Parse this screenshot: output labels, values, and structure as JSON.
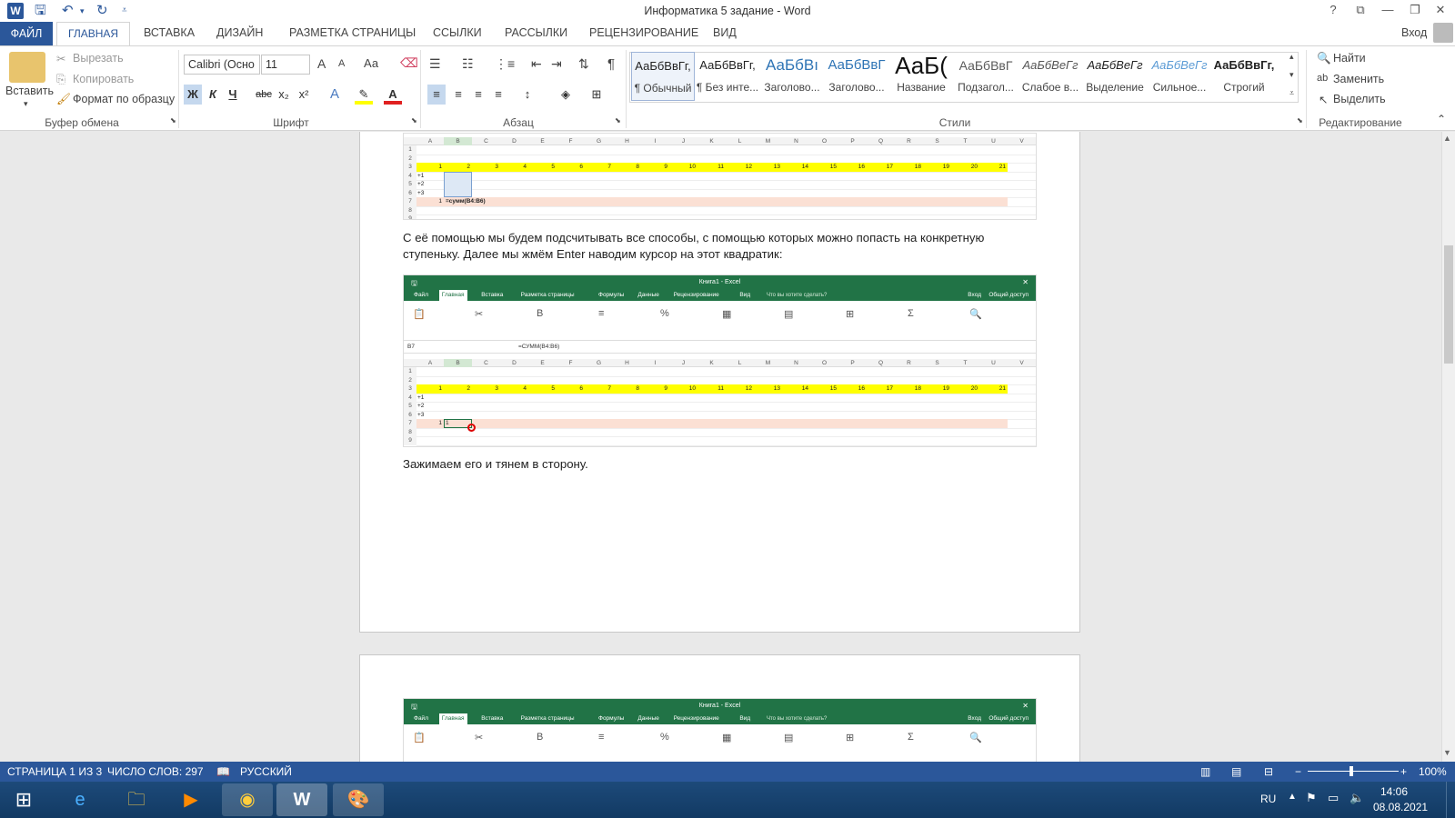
{
  "window": {
    "title": "Информатика 5 задание - Word",
    "help": "?",
    "signin": "Вход"
  },
  "tabs": [
    "ФАЙЛ",
    "ГЛАВНАЯ",
    "ВСТАВКА",
    "ДИЗАЙН",
    "РАЗМЕТКА СТРАНИЦЫ",
    "ССЫЛКИ",
    "РАССЫЛКИ",
    "РЕЦЕНЗИРОВАНИЕ",
    "ВИД"
  ],
  "clipboard": {
    "paste": "Вставить",
    "cut": "Вырезать",
    "copy": "Копировать",
    "format_painter": "Формат по образцу",
    "label": "Буфер обмена"
  },
  "font": {
    "name": "Calibri (Осно",
    "size": "11",
    "label": "Шрифт",
    "bold": "Ж",
    "italic": "К",
    "underline": "Ч",
    "strike": "abc",
    "sub": "x₂",
    "sup": "x²",
    "grow": "A",
    "shrink": "A",
    "case": "Аа"
  },
  "paragraph": {
    "label": "Абзац"
  },
  "styles": {
    "label": "Стили",
    "items": [
      {
        "preview": "АаБбВвГг,",
        "name": "¶ Обычный"
      },
      {
        "preview": "АаБбВвГг,",
        "name": "¶ Без инте..."
      },
      {
        "preview": "АаБбВı",
        "name": "Заголово..."
      },
      {
        "preview": "АаБбВвГ",
        "name": "Заголово..."
      },
      {
        "preview": "АаБ(",
        "name": "Название"
      },
      {
        "preview": "АаБбВвГ",
        "name": "Подзагол..."
      },
      {
        "preview": "АаБбВеГг",
        "name": "Слабое в..."
      },
      {
        "preview": "АаБбВеГг",
        "name": "Выделение"
      },
      {
        "preview": "АаБбВеГг",
        "name": "Сильное..."
      },
      {
        "preview": "АаБбВвГг,",
        "name": "Строгий"
      }
    ]
  },
  "editing": {
    "find": "Найти",
    "replace": "Заменить",
    "select": "Выделить",
    "label": "Редактирование"
  },
  "document": {
    "para1": "С её помощью мы будем подсчитывать все способы, с помощью которых можно попасть на конкретную",
    "para1b": "ступеньку. Далее мы жмём Enter наводим курсор на этот квадратик:",
    "para2": "Зажимаем его и тянем в сторону."
  },
  "excel": {
    "title": "Книга1 - Excel",
    "tabs": [
      "Файл",
      "Главная",
      "Вставка",
      "Разметка страницы",
      "Формулы",
      "Данные",
      "Рецензирование",
      "Вид"
    ],
    "tellme": "Что вы хотите сделать?",
    "login": "Вход",
    "share": "Общий доступ",
    "namebox": "B7",
    "formula": "=СУММ(B4:B6)",
    "cols": [
      "A",
      "B",
      "C",
      "D",
      "E",
      "F",
      "G",
      "H",
      "I",
      "J",
      "K",
      "L",
      "M",
      "N",
      "O",
      "P",
      "Q",
      "R",
      "S",
      "T",
      "U",
      "V"
    ],
    "row3": [
      "1",
      "2",
      "3",
      "4",
      "5",
      "6",
      "7",
      "8",
      "9",
      "10",
      "11",
      "12",
      "13",
      "14",
      "15",
      "16",
      "17",
      "18",
      "19",
      "20",
      "21"
    ],
    "rowlabels": [
      "+1",
      "+2",
      "+3"
    ],
    "a7": "1",
    "b7_formula": "=сумм(B4:B6)",
    "b7_value": "1"
  },
  "status": {
    "page": "СТРАНИЦА 1 ИЗ 3",
    "words": "ЧИСЛО СЛОВ: 297",
    "lang": "РУССКИЙ",
    "zoom": "100%"
  },
  "taskbar": {
    "lang": "RU",
    "time": "14:06",
    "date": "08.08.2021"
  },
  "colors": {
    "word_blue": "#2b579a",
    "excel_green": "#217346",
    "yellow": "#ffff00",
    "pink": "#fbe0d4"
  }
}
